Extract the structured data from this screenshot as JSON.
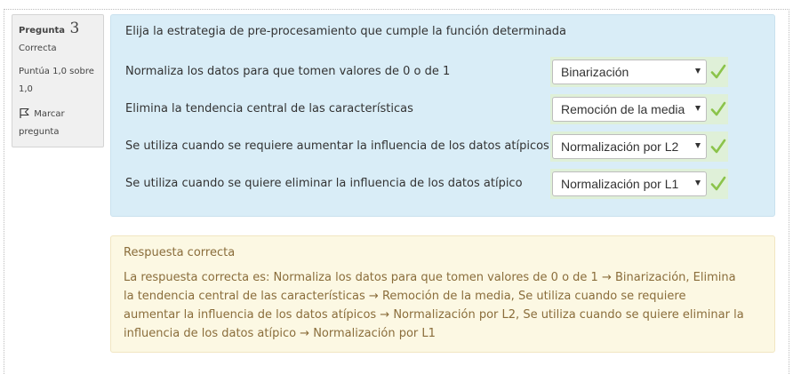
{
  "info": {
    "question_label": "Pregunta",
    "question_number": "3",
    "state": "Correcta",
    "grade": "Puntúa 1,0 sobre 1,0",
    "flag_label": "Marcar pregunta"
  },
  "question": {
    "text": "Elija la estrategia de pre-procesamiento que cumple la función determinada",
    "rows": [
      {
        "label": "Normaliza los datos para que tomen valores de 0 o de 1",
        "selected": "Binarización"
      },
      {
        "label": "Elimina la tendencia central de las características",
        "selected": "Remoción de la media"
      },
      {
        "label": "Se utiliza cuando se requiere aumentar la influencia de los datos atípicos",
        "selected": "Normalización por L2"
      },
      {
        "label": "Se utiliza cuando se quiere eliminar la influencia de los datos atípico",
        "selected": "Normalización por L1"
      }
    ]
  },
  "feedback": {
    "title": "Respuesta correcta",
    "text": "La respuesta correcta es: Normaliza los datos para que tomen valores de 0 o de 1 → Binarización, Elimina la tendencia central de las características → Remoción de la media, Se utiliza cuando se requiere aumentar la influencia de los datos atípicos → Normalización por L2, Se utiliza cuando se quiere eliminar la influencia de los datos atípico → Normalización por L1"
  },
  "colors": {
    "formulation_bg": "#d9edf7",
    "correct_cell_bg": "#dff0d8",
    "check_green": "#8bc34a",
    "feedback_bg": "#fcf8e3",
    "feedback_text": "#8a6d3b"
  },
  "icons": {
    "flag": "flag-icon",
    "check": "check-icon",
    "dropdown": "chevron-down-icon"
  }
}
